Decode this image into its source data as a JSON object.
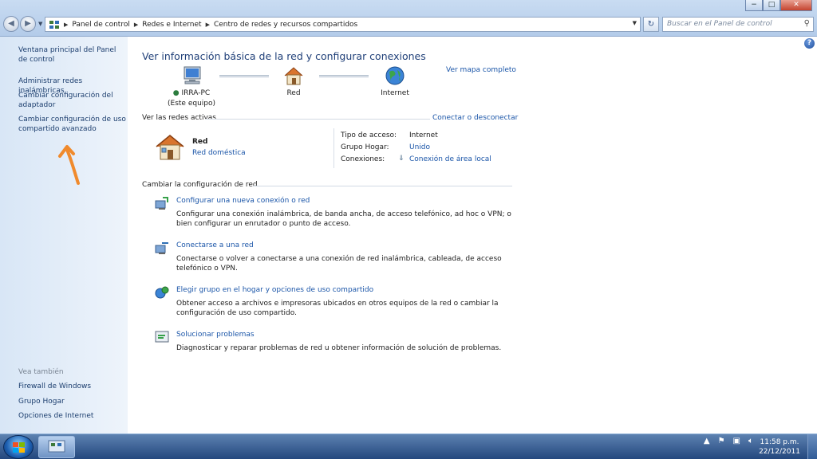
{
  "window_controls": {
    "minimize": "−",
    "maximize": "□",
    "close": "✕"
  },
  "nav": {
    "back": "◀",
    "forward": "▶"
  },
  "address": {
    "crumbs": [
      "Panel de control",
      "Redes e Internet",
      "Centro de redes y recursos compartidos"
    ]
  },
  "search": {
    "placeholder": "Buscar en el Panel de control"
  },
  "left_pane": {
    "links": [
      "Ventana principal del Panel de control",
      "Administrar redes inalámbricas",
      "Cambiar configuración del adaptador",
      "Cambiar configuración de uso compartido avanzado"
    ],
    "see_also_label": "Vea también",
    "see_also": [
      "Firewall de Windows",
      "Grupo Hogar",
      "Opciones de Internet"
    ]
  },
  "main": {
    "title": "Ver información básica de la red y configurar conexiones",
    "full_map": "Ver mapa completo",
    "map": {
      "computer_name": "IRRA-PC",
      "computer_sub": "(Este equipo)",
      "network": "Red",
      "internet": "Internet"
    },
    "active_networks_label": "Ver las redes activas",
    "connect_disconnect": "Conectar o desconectar",
    "active_network": {
      "name": "Red",
      "type": "Red doméstica",
      "access_type_label": "Tipo de acceso:",
      "access_type": "Internet",
      "homegroup_label": "Grupo Hogar:",
      "homegroup": "Unido",
      "connections_label": "Conexiones:",
      "connection": "Conexión de área local"
    },
    "change_settings_label": "Cambiar la configuración de red",
    "tasks": [
      {
        "title": "Configurar una nueva conexión o red",
        "desc": "Configurar una conexión inalámbrica, de banda ancha, de acceso telefónico, ad hoc o VPN; o bien configurar un enrutador o punto de acceso."
      },
      {
        "title": "Conectarse a una red",
        "desc": "Conectarse o volver a conectarse a una conexión de red inalámbrica, cableada, de acceso telefónico o VPN."
      },
      {
        "title": "Elegir grupo en el hogar y opciones de uso compartido",
        "desc": "Obtener acceso a archivos e impresoras ubicados en otros equipos de la red o cambiar la configuración de uso compartido."
      },
      {
        "title": "Solucionar problemas",
        "desc": "Diagnosticar y reparar problemas de red u obtener información de solución de problemas."
      }
    ]
  },
  "taskbar": {
    "time": "11:58 p.m.",
    "date": "22/12/2011"
  },
  "colors": {
    "link": "#1a55a8",
    "title": "#1f3f78",
    "annotation_arrow": "#f08a2c"
  }
}
